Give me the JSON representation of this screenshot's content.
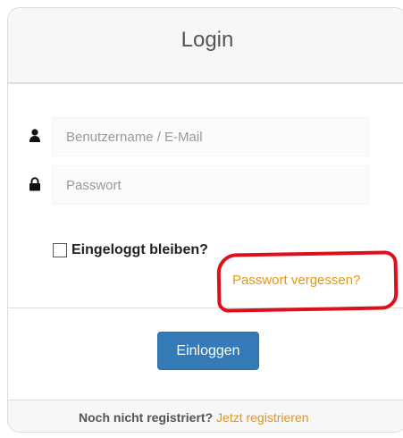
{
  "login": {
    "title": "Login",
    "username_placeholder": "Benutzername / E-Mail",
    "password_placeholder": "Passwort",
    "remember_label": "Eingeloggt bleiben?",
    "remember_checked": false,
    "forgot_password_link": "Passwort vergessen?",
    "submit_label": "Einloggen"
  },
  "footer": {
    "prompt": "Noch nicht registriert?",
    "register_link": "Jetzt registrieren"
  },
  "icons": {
    "username": "user-icon",
    "password": "lock-icon"
  },
  "colors": {
    "primary_button": "#337ab7",
    "link": "#e8960b",
    "highlight": "#e0101b"
  }
}
